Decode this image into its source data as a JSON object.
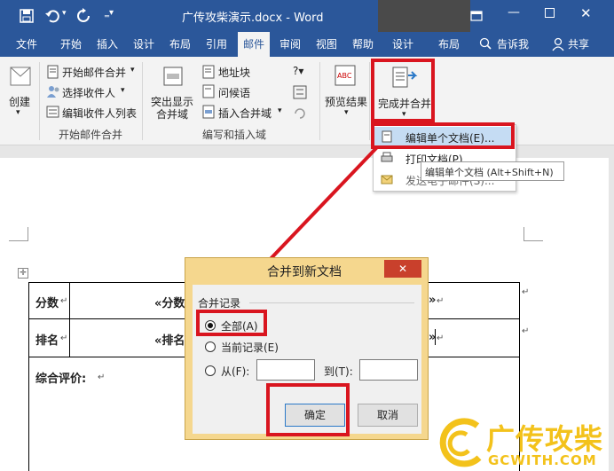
{
  "titlebar": {
    "doc_title": "广传攻柴演示.docx  -  Word",
    "login_label": "登录",
    "qat_icons": [
      "save-icon",
      "undo-icon",
      "redo-icon",
      "customize-icon"
    ]
  },
  "tabs": [
    {
      "label": "文件"
    },
    {
      "label": "开始"
    },
    {
      "label": "插入"
    },
    {
      "label": "设计"
    },
    {
      "label": "布局"
    },
    {
      "label": "引用"
    },
    {
      "label": "邮件"
    },
    {
      "label": "审阅"
    },
    {
      "label": "视图"
    },
    {
      "label": "帮助"
    },
    {
      "label": "设计"
    },
    {
      "label": "布局"
    }
  ],
  "tell_me": "告诉我",
  "share": "共享",
  "ribbon": {
    "create_label": "创建",
    "start_merge_label": "开始邮件合并",
    "select_recipients_label": "选择收件人",
    "edit_recipients_label": "编辑收件人列表",
    "group_start_merge": "开始邮件合并",
    "highlight_fields_label": "突出显示\n合并域",
    "address_block_label": "地址块",
    "greeting_line_label": "问候语",
    "insert_field_label": "插入合并域",
    "group_write_insert": "编写和插入域",
    "preview_label": "预览结果",
    "finish_merge_label": "完成并合并"
  },
  "finish_menu": {
    "items": [
      {
        "label": "编辑单个文档(E)..."
      },
      {
        "label": "打印文档(P)..."
      },
      {
        "label": "发送电子邮件(S)..."
      }
    ],
    "tooltip": "编辑单个文档 (Alt+Shift+N)"
  },
  "document": {
    "score_label": "分数",
    "score_field": "«分数",
    "rank_label": "排名",
    "rank_field": "«排名",
    "field_end_1": "»",
    "field_end_2": "»",
    "evaluation_label": "综合评价:"
  },
  "dialog": {
    "title": "合并到新文档",
    "group_label": "合并记录",
    "all_label": "全部(A)",
    "current_label": "当前记录(E)",
    "from_label": "从(F):",
    "to_label": "到(T):",
    "from_value": "",
    "to_value": "",
    "ok_label": "确定",
    "cancel_label": "取消",
    "close_label": "✕"
  },
  "watermark": {
    "text": "广传攻柴",
    "site": "GCWITH.COM"
  }
}
